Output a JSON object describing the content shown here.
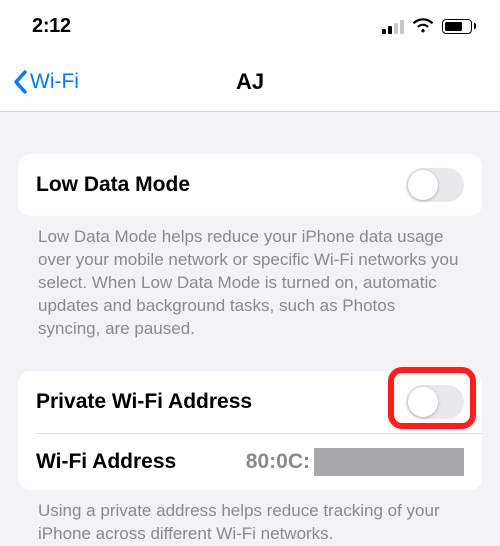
{
  "status": {
    "time": "2:12"
  },
  "nav": {
    "back_label": "Wi-Fi",
    "title": "AJ"
  },
  "section1": {
    "row1_label": "Low Data Mode",
    "footer": "Low Data Mode helps reduce your iPhone data usage over your mobile network or specific Wi-Fi networks you select. When Low Data Mode is turned on, automatic updates and background tasks, such as Photos syncing, are paused."
  },
  "section2": {
    "row1_label": "Private Wi-Fi Address",
    "row2_label": "Wi-Fi Address",
    "row2_value_visible": "80:0C:",
    "footer": "Using a private address helps reduce tracking of your iPhone across different Wi-Fi networks."
  }
}
